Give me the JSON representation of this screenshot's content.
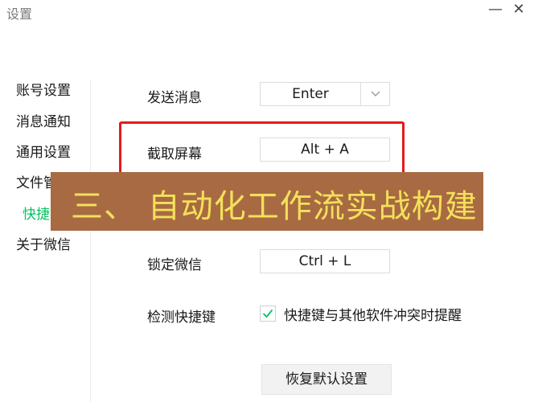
{
  "window": {
    "title": "设置",
    "minimize_icon": "minimize-icon",
    "close_icon": "close-icon"
  },
  "sidebar": {
    "items": [
      {
        "label": "账号设置"
      },
      {
        "label": "消息通知"
      },
      {
        "label": "通用设置"
      },
      {
        "label": "文件管"
      },
      {
        "label": "快捷",
        "active": true
      },
      {
        "label": "关于微信"
      }
    ],
    "active_color": "#07c160"
  },
  "shortcuts": {
    "send_message": {
      "label": "发送消息",
      "value": "Enter",
      "dropdown_icon": "chevron-down-icon"
    },
    "screenshot": {
      "label": "截取屏幕",
      "value": "Alt + A"
    },
    "lock": {
      "label": "锁定微信",
      "value": "Ctrl + L"
    },
    "detect": {
      "label": "检测快捷键",
      "checkbox_label": "快捷键与其他软件冲突时提醒",
      "checked": true
    }
  },
  "restore_button": {
    "label": "恢复默认设置"
  },
  "overlay_banner": {
    "text": "三、 自动化工作流实战构建",
    "background": "#a86a42",
    "text_color": "#f3e05a"
  },
  "highlight_color": "#e41b1b"
}
